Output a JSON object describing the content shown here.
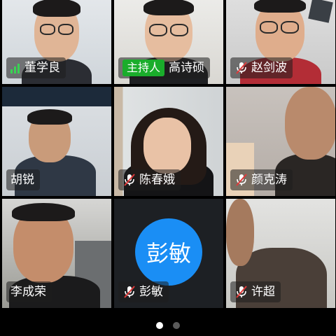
{
  "participants": [
    {
      "name": "董学良",
      "mic": "active",
      "is_host": false
    },
    {
      "name": "高诗硕",
      "mic": "none",
      "is_host": true,
      "host_label": "主持人"
    },
    {
      "name": "赵剑波",
      "mic": "muted",
      "is_host": false
    },
    {
      "name": "胡锐",
      "mic": "none",
      "is_host": false
    },
    {
      "name": "陈春娥",
      "mic": "muted",
      "is_host": false
    },
    {
      "name": "颜克涛",
      "mic": "muted",
      "is_host": false
    },
    {
      "name": "李成荣",
      "mic": "none",
      "is_host": false
    },
    {
      "name": "彭敏",
      "mic": "muted",
      "is_host": false,
      "avatar_text": "彭敏",
      "avatar_color": "#1a8ef5"
    },
    {
      "name": "许超",
      "mic": "muted",
      "is_host": false
    }
  ],
  "pager": {
    "pages": 2,
    "current": 1
  },
  "colors": {
    "background": "#000000",
    "host_badge": "#1aad2b",
    "signal": "#39d353",
    "muted_slash": "#e03a3a"
  }
}
